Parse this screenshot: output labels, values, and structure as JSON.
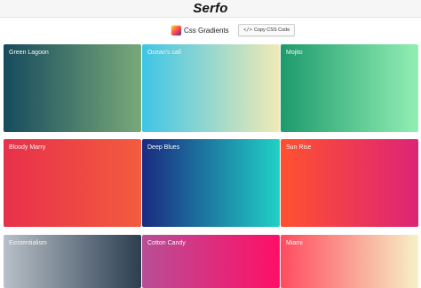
{
  "header": {
    "brand": "Serfo"
  },
  "toolbar": {
    "logo_label": "Css Gradients",
    "copy_button": {
      "icon_glyph": "</>",
      "label": "Copy CSS Code"
    }
  },
  "gradients": [
    {
      "name": "Green Lagoon",
      "from": "#164b5d",
      "to": "#79a979"
    },
    {
      "name": "Ocean's call",
      "from": "#3ec5e6",
      "to": "#f1eab5"
    },
    {
      "name": "Mojito",
      "from": "#1d9a6c",
      "to": "#92efb4"
    },
    {
      "name": "Bloody Marry",
      "from": "#e8304a",
      "to": "#f25c3f"
    },
    {
      "name": "Deep Blues",
      "from": "#1a2a80",
      "to": "#20d1c6"
    },
    {
      "name": "Sun Rise",
      "from": "#ff512f",
      "to": "#dd2476"
    },
    {
      "name": "Existentialism",
      "from": "#b8c0c8",
      "to": "#2c3e50"
    },
    {
      "name": "Cotton Candy",
      "from": "#b84e96",
      "to": "#ff0f66"
    },
    {
      "name": "Miami",
      "from": "#ff4b5f",
      "to": "#f6f1c6"
    }
  ]
}
